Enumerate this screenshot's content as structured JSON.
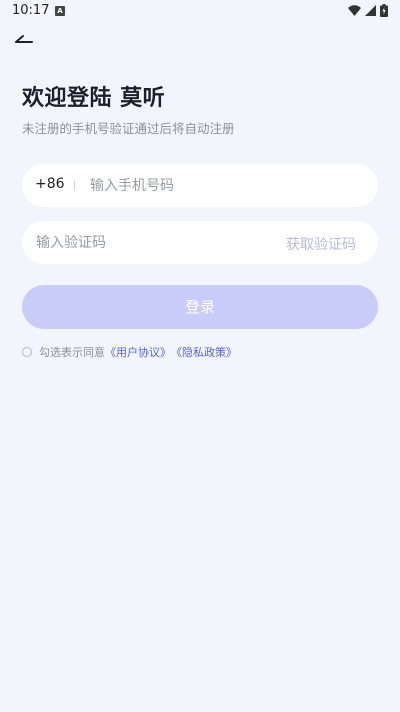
{
  "status_bar": {
    "time": "10:17",
    "app_icon_letter": "A"
  },
  "header": {
    "title": "欢迎登陆 莫听",
    "subtitle": "未注册的手机号验证通过后将自动注册"
  },
  "phone_field": {
    "country_code": "+86",
    "placeholder": "输入手机号码"
  },
  "code_field": {
    "placeholder": "输入验证码",
    "get_code_label": "获取验证码"
  },
  "login_button": {
    "label": "登录"
  },
  "agreement": {
    "prefix": "勾选表示同意",
    "user_agreement": "《用户协议》",
    "privacy_policy": "《隐私政策》"
  },
  "colors": {
    "background": "#f3f5fd",
    "button": "#c9cbf8",
    "link": "#5b62d8"
  }
}
